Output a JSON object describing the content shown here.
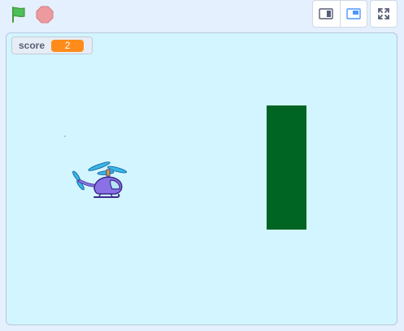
{
  "toolbar": {
    "flag": {
      "icon": "green-flag-icon",
      "color": "#4cbf56"
    },
    "stop": {
      "icon": "stop-sign-icon",
      "color": "#ec5959"
    },
    "small_stage_mode": {
      "icon": "small-stage-icon"
    },
    "normal_stage_mode": {
      "icon": "normal-stage-icon",
      "active": true
    },
    "fullscreen": {
      "icon": "fullscreen-icon"
    }
  },
  "stage": {
    "background": "#d2f5ff",
    "monitor": {
      "label": "score",
      "value": "2",
      "value_color": "#ff8c1a"
    },
    "sprites": [
      {
        "name": "helicopter",
        "icon": "helicopter-sprite"
      },
      {
        "name": "pipe",
        "color": "#006422"
      }
    ]
  }
}
